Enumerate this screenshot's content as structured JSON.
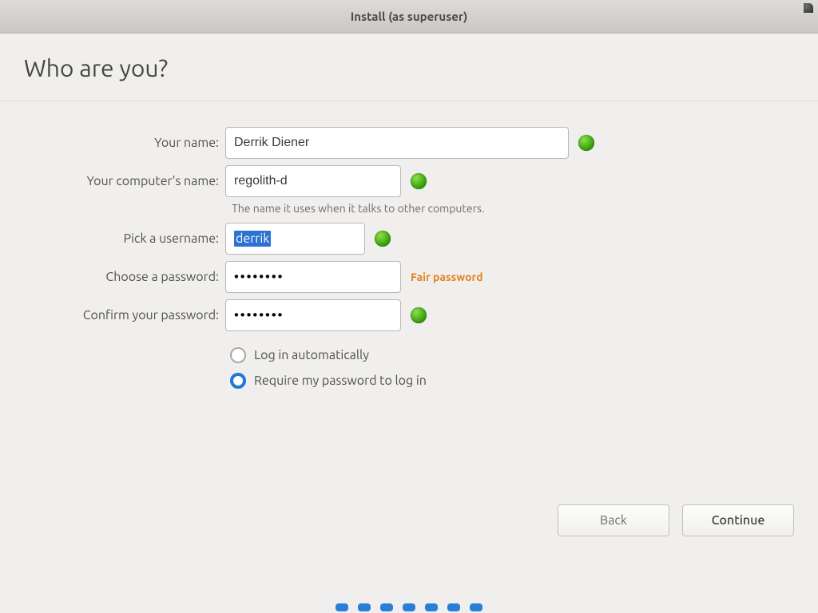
{
  "window": {
    "title": "Install (as superuser)"
  },
  "heading": "Who are you?",
  "labels": {
    "name": "Your name:",
    "computer": "Your computer's name:",
    "computer_hint": "The name it uses when it talks to other computers.",
    "username": "Pick a username:",
    "password": "Choose a password:",
    "confirm": "Confirm your password:"
  },
  "values": {
    "name": "Derrik Diener",
    "computer": "regolith-d",
    "username": "derrik",
    "password": "••••••••",
    "confirm": "••••••••"
  },
  "password_strength": "Fair password",
  "login": {
    "auto": "Log in automatically",
    "require": "Require my password to log in",
    "selected": "require"
  },
  "buttons": {
    "back": "Back",
    "continue": "Continue"
  },
  "colors": {
    "accent": "#1e78d6",
    "ok": "#3ba50f",
    "warn": "#e77f1d"
  }
}
